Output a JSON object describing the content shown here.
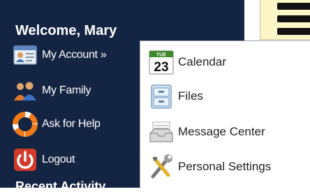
{
  "sidebar": {
    "welcome": "Welcome, Mary",
    "items": [
      {
        "label": "My Account »",
        "icon": "account-card-icon"
      },
      {
        "label": "My Family",
        "icon": "family-icon"
      },
      {
        "label": "Ask for Help",
        "icon": "life-ring-icon"
      },
      {
        "label": "Logout",
        "icon": "power-icon"
      }
    ],
    "partial_heading": "Recent Activity"
  },
  "dropdown": {
    "items": [
      {
        "label": "Calendar",
        "icon": "calendar-icon",
        "icon_month": "TUE",
        "icon_day": "23"
      },
      {
        "label": "Files",
        "icon": "file-cabinet-icon"
      },
      {
        "label": "Message Center",
        "icon": "inbox-tray-icon"
      },
      {
        "label": "Personal Settings",
        "icon": "tools-icon"
      }
    ]
  },
  "colors": {
    "sidebar_bg": "#142544",
    "note_bg": "#fdf7c7",
    "menu_bg": "#ffffff",
    "text_light": "#ffffff",
    "text_dark": "#222222"
  }
}
